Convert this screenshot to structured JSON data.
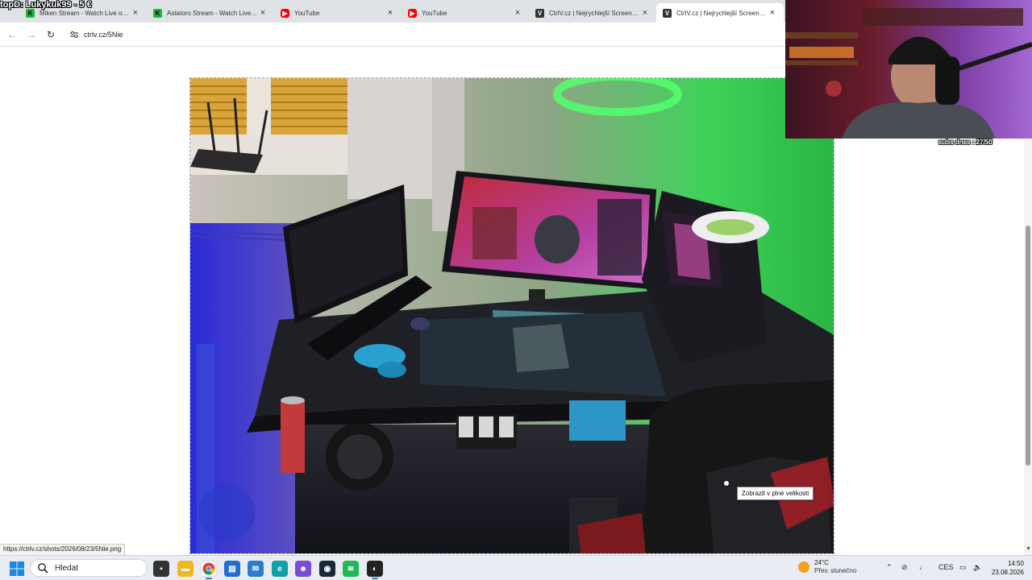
{
  "donation_text": "topD: Lukykuk99 - 5 €",
  "tabs": [
    {
      "title": "Miken Stream - Watch Live on Kick",
      "favicon": "kick-icon"
    },
    {
      "title": "Astatoro Stream - Watch Live on Kick",
      "favicon": "kick-icon"
    },
    {
      "title": "YouTube",
      "favicon": "youtube-icon"
    },
    {
      "title": "YouTube",
      "favicon": "youtube-icon"
    },
    {
      "title": "CtrlV.cz | Nejrychlejší ScreenShot",
      "favicon": "ctrlv-icon"
    },
    {
      "title": "CtrlV.cz | Nejrychlejší ScreenShot",
      "favicon": "ctrlv-icon"
    }
  ],
  "address": {
    "url": "ctrlv.cz/5Nie"
  },
  "image": {
    "tooltip": "Zobrazit v plné velikosti"
  },
  "status_url": "https://ctrlv.cz/shots/2026/08/23/5Nie.png",
  "webcam": {
    "subs_text": "subs dnes : 27/50"
  },
  "taskbar": {
    "search_placeholder": "Hledat",
    "weather_temp": "24°C",
    "weather_desc": "Přev. slunečno",
    "language": "CES",
    "time": "14:50",
    "date": "23.08.2026"
  },
  "colors": {
    "youtube": "#ff0000",
    "kick": "#1fb83d",
    "taskbar_bg": "#e9edf3",
    "tab_strip_bg": "#dfe3e8"
  }
}
